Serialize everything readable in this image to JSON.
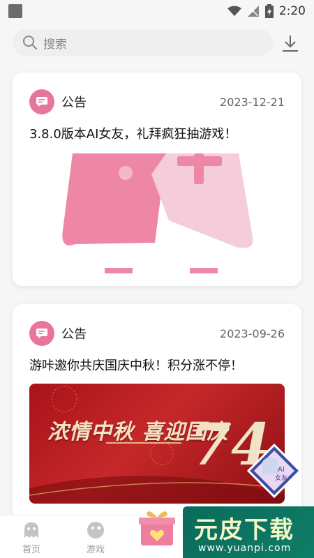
{
  "status_bar": {
    "time": "2:20"
  },
  "search": {
    "placeholder": "搜索"
  },
  "feed": {
    "items": [
      {
        "label": "公告",
        "date": "2023-12-21",
        "title": "3.8.0版本AI女友，礼拜疯狂抽游戏！"
      },
      {
        "label": "公告",
        "date": "2023-09-26",
        "title": "游咔邀你共庆国庆中秋！积分涨不停！",
        "banner_text": "浓情中秋 喜迎国庆",
        "banner_number": "74"
      }
    ]
  },
  "avatar_badge": {
    "line1": "AI",
    "line2": "女友"
  },
  "bottom_nav": {
    "home_label": "首页",
    "games_label": "游戏"
  },
  "watermark": {
    "main": "元皮下载",
    "sub": "www.yuanpi.com"
  },
  "colors": {
    "accent": "#e8769a",
    "banner_red": "#c6282a",
    "watermark_green": "#0f7d66"
  },
  "icons": {
    "search": "search-icon",
    "download": "download-icon",
    "notice": "message-icon",
    "home": "ghost-icon",
    "games": "gamepad-icon",
    "gift": "gift-icon"
  }
}
